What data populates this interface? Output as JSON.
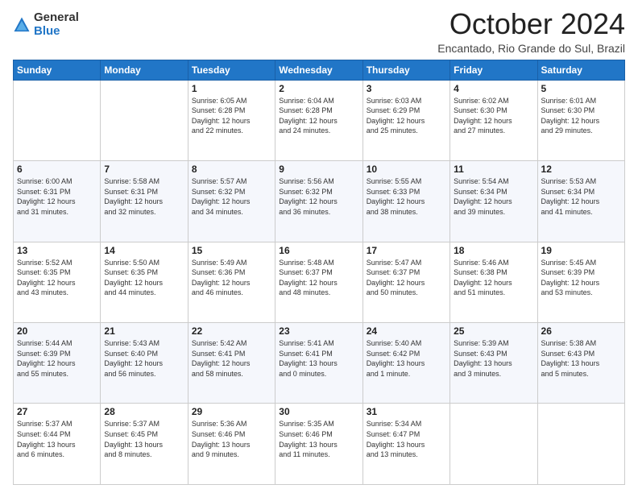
{
  "logo": {
    "general": "General",
    "blue": "Blue"
  },
  "title": "October 2024",
  "subtitle": "Encantado, Rio Grande do Sul, Brazil",
  "days_of_week": [
    "Sunday",
    "Monday",
    "Tuesday",
    "Wednesday",
    "Thursday",
    "Friday",
    "Saturday"
  ],
  "weeks": [
    [
      {
        "day": "",
        "info": ""
      },
      {
        "day": "",
        "info": ""
      },
      {
        "day": "1",
        "info": "Sunrise: 6:05 AM\nSunset: 6:28 PM\nDaylight: 12 hours\nand 22 minutes."
      },
      {
        "day": "2",
        "info": "Sunrise: 6:04 AM\nSunset: 6:28 PM\nDaylight: 12 hours\nand 24 minutes."
      },
      {
        "day": "3",
        "info": "Sunrise: 6:03 AM\nSunset: 6:29 PM\nDaylight: 12 hours\nand 25 minutes."
      },
      {
        "day": "4",
        "info": "Sunrise: 6:02 AM\nSunset: 6:30 PM\nDaylight: 12 hours\nand 27 minutes."
      },
      {
        "day": "5",
        "info": "Sunrise: 6:01 AM\nSunset: 6:30 PM\nDaylight: 12 hours\nand 29 minutes."
      }
    ],
    [
      {
        "day": "6",
        "info": "Sunrise: 6:00 AM\nSunset: 6:31 PM\nDaylight: 12 hours\nand 31 minutes."
      },
      {
        "day": "7",
        "info": "Sunrise: 5:58 AM\nSunset: 6:31 PM\nDaylight: 12 hours\nand 32 minutes."
      },
      {
        "day": "8",
        "info": "Sunrise: 5:57 AM\nSunset: 6:32 PM\nDaylight: 12 hours\nand 34 minutes."
      },
      {
        "day": "9",
        "info": "Sunrise: 5:56 AM\nSunset: 6:32 PM\nDaylight: 12 hours\nand 36 minutes."
      },
      {
        "day": "10",
        "info": "Sunrise: 5:55 AM\nSunset: 6:33 PM\nDaylight: 12 hours\nand 38 minutes."
      },
      {
        "day": "11",
        "info": "Sunrise: 5:54 AM\nSunset: 6:34 PM\nDaylight: 12 hours\nand 39 minutes."
      },
      {
        "day": "12",
        "info": "Sunrise: 5:53 AM\nSunset: 6:34 PM\nDaylight: 12 hours\nand 41 minutes."
      }
    ],
    [
      {
        "day": "13",
        "info": "Sunrise: 5:52 AM\nSunset: 6:35 PM\nDaylight: 12 hours\nand 43 minutes."
      },
      {
        "day": "14",
        "info": "Sunrise: 5:50 AM\nSunset: 6:35 PM\nDaylight: 12 hours\nand 44 minutes."
      },
      {
        "day": "15",
        "info": "Sunrise: 5:49 AM\nSunset: 6:36 PM\nDaylight: 12 hours\nand 46 minutes."
      },
      {
        "day": "16",
        "info": "Sunrise: 5:48 AM\nSunset: 6:37 PM\nDaylight: 12 hours\nand 48 minutes."
      },
      {
        "day": "17",
        "info": "Sunrise: 5:47 AM\nSunset: 6:37 PM\nDaylight: 12 hours\nand 50 minutes."
      },
      {
        "day": "18",
        "info": "Sunrise: 5:46 AM\nSunset: 6:38 PM\nDaylight: 12 hours\nand 51 minutes."
      },
      {
        "day": "19",
        "info": "Sunrise: 5:45 AM\nSunset: 6:39 PM\nDaylight: 12 hours\nand 53 minutes."
      }
    ],
    [
      {
        "day": "20",
        "info": "Sunrise: 5:44 AM\nSunset: 6:39 PM\nDaylight: 12 hours\nand 55 minutes."
      },
      {
        "day": "21",
        "info": "Sunrise: 5:43 AM\nSunset: 6:40 PM\nDaylight: 12 hours\nand 56 minutes."
      },
      {
        "day": "22",
        "info": "Sunrise: 5:42 AM\nSunset: 6:41 PM\nDaylight: 12 hours\nand 58 minutes."
      },
      {
        "day": "23",
        "info": "Sunrise: 5:41 AM\nSunset: 6:41 PM\nDaylight: 13 hours\nand 0 minutes."
      },
      {
        "day": "24",
        "info": "Sunrise: 5:40 AM\nSunset: 6:42 PM\nDaylight: 13 hours\nand 1 minute."
      },
      {
        "day": "25",
        "info": "Sunrise: 5:39 AM\nSunset: 6:43 PM\nDaylight: 13 hours\nand 3 minutes."
      },
      {
        "day": "26",
        "info": "Sunrise: 5:38 AM\nSunset: 6:43 PM\nDaylight: 13 hours\nand 5 minutes."
      }
    ],
    [
      {
        "day": "27",
        "info": "Sunrise: 5:37 AM\nSunset: 6:44 PM\nDaylight: 13 hours\nand 6 minutes."
      },
      {
        "day": "28",
        "info": "Sunrise: 5:37 AM\nSunset: 6:45 PM\nDaylight: 13 hours\nand 8 minutes."
      },
      {
        "day": "29",
        "info": "Sunrise: 5:36 AM\nSunset: 6:46 PM\nDaylight: 13 hours\nand 9 minutes."
      },
      {
        "day": "30",
        "info": "Sunrise: 5:35 AM\nSunset: 6:46 PM\nDaylight: 13 hours\nand 11 minutes."
      },
      {
        "day": "31",
        "info": "Sunrise: 5:34 AM\nSunset: 6:47 PM\nDaylight: 13 hours\nand 13 minutes."
      },
      {
        "day": "",
        "info": ""
      },
      {
        "day": "",
        "info": ""
      }
    ]
  ]
}
